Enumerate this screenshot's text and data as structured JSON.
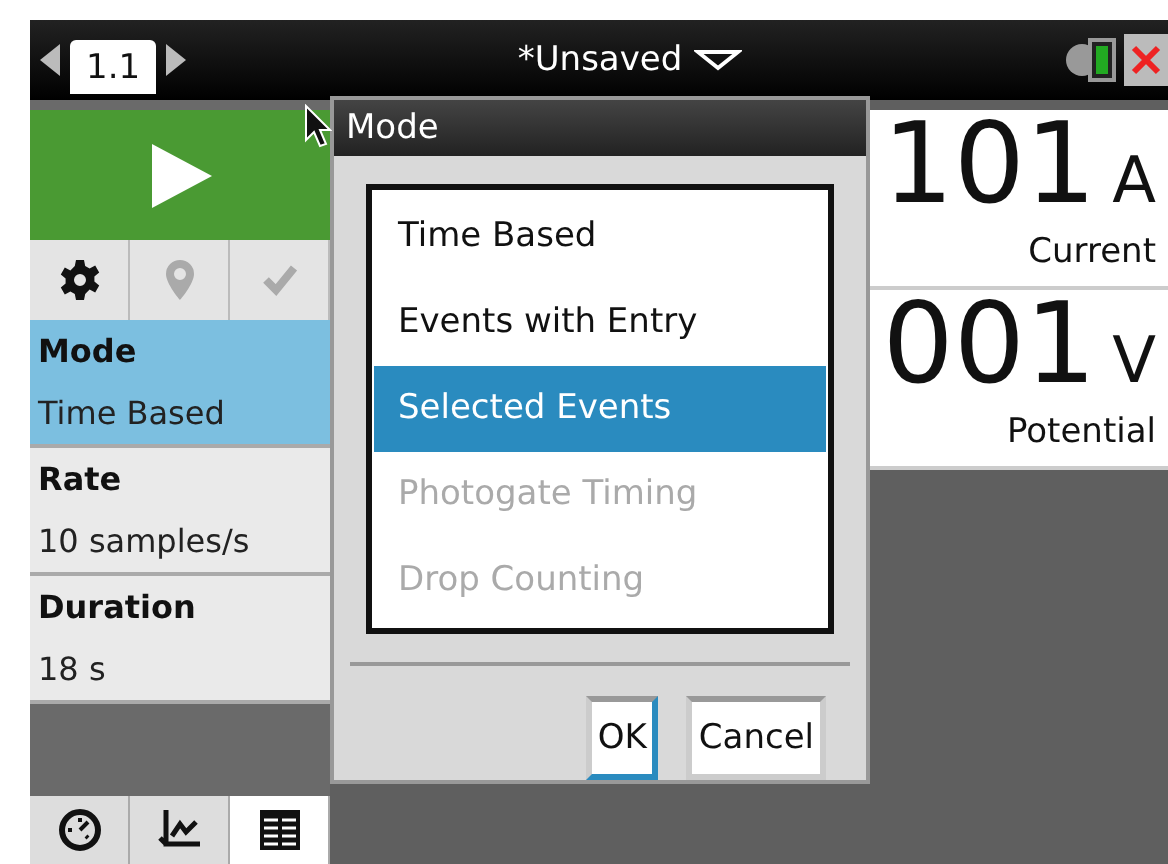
{
  "top_bar": {
    "page_tab": "1.1",
    "title": "*Unsaved"
  },
  "toolbar": [
    {
      "kind": "settings",
      "disabled": false
    },
    {
      "kind": "pin",
      "disabled": true
    },
    {
      "kind": "check",
      "disabled": true
    }
  ],
  "settings": [
    {
      "label": "Mode",
      "value": "Time Based",
      "selected": true
    },
    {
      "label": "Rate",
      "value": "10 samples/s",
      "selected": false
    },
    {
      "label": "Duration",
      "value": "18 s",
      "selected": false
    }
  ],
  "view_tabs": [
    {
      "kind": "meter",
      "selected": false
    },
    {
      "kind": "graph",
      "selected": false
    },
    {
      "kind": "table",
      "selected": true
    }
  ],
  "dialog": {
    "title": "Mode",
    "options": [
      {
        "label": "Time Based",
        "selected": false,
        "disabled": false
      },
      {
        "label": "Events with Entry",
        "selected": false,
        "disabled": false
      },
      {
        "label": "Selected Events",
        "selected": true,
        "disabled": false
      },
      {
        "label": "Photogate Timing",
        "selected": false,
        "disabled": true
      },
      {
        "label": "Drop Counting",
        "selected": false,
        "disabled": true
      }
    ],
    "buttons": [
      {
        "label": "OK",
        "focused": true
      },
      {
        "label": "Cancel",
        "focused": false
      }
    ]
  },
  "meters": [
    {
      "value": "101",
      "unit": "A",
      "name": "Current"
    },
    {
      "value": "001",
      "unit": "V",
      "name": "Potential"
    }
  ]
}
